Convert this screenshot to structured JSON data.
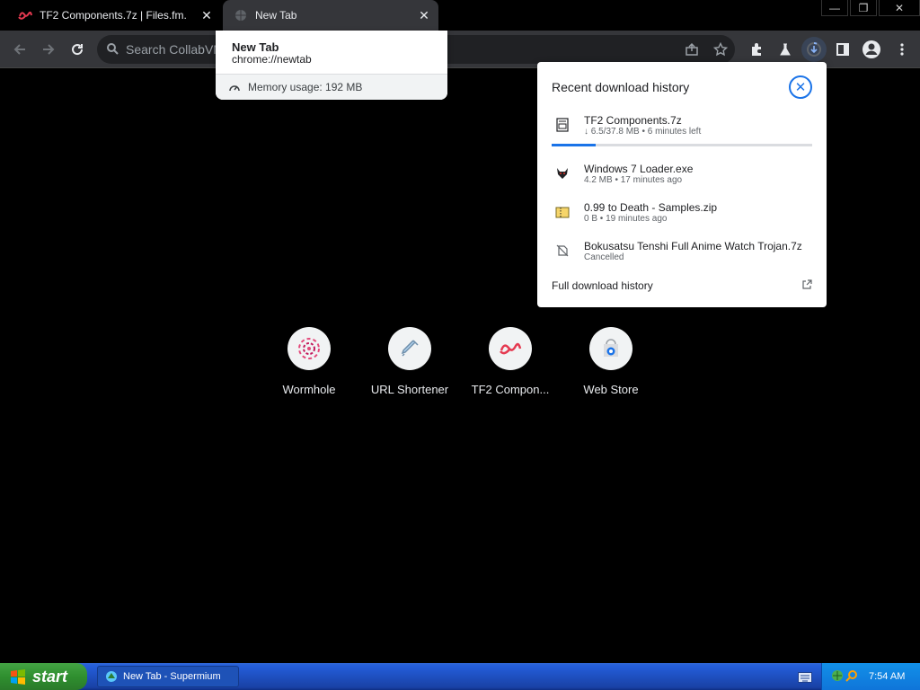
{
  "tabs": [
    {
      "title": "TF2 Components.7z | Files.fm.",
      "close": "✕"
    },
    {
      "title": "New Tab",
      "close": "✕"
    }
  ],
  "window_controls": {
    "minimize": "—",
    "restore": "❐",
    "close": "✕"
  },
  "omnibox": {
    "placeholder": "Search CollabVM"
  },
  "hover_card": {
    "title": "New Tab",
    "url": "chrome://newtab",
    "memory": "Memory usage: 192 MB"
  },
  "downloads": {
    "title": "Recent download history",
    "items": [
      {
        "name": "TF2 Components.7z",
        "status": "↓ 6.5/37.8 MB • 6 minutes left",
        "icon": "archive-icon",
        "progress": 0.17
      },
      {
        "name": "Windows  7  Loader.exe",
        "status": "4.2 MB • 17 minutes ago",
        "icon": "demon-cat-icon"
      },
      {
        "name": "0.99 to Death - Samples.zip",
        "status": "0 B • 19 minutes ago",
        "icon": "zip-folder-icon"
      },
      {
        "name": "Bokusatsu Tenshi Full Anime Watch Trojan.7z",
        "status": "Cancelled",
        "icon": "file-off-icon"
      }
    ],
    "footer": "Full download history"
  },
  "shortcuts": [
    {
      "label": "Wormhole",
      "icon": "wormhole-icon"
    },
    {
      "label": "URL Shortener",
      "icon": "syringe-icon"
    },
    {
      "label": "TF2 Compon...",
      "icon": "filesfm-icon"
    },
    {
      "label": "Web Store",
      "icon": "webstore-icon"
    }
  ],
  "taskbar": {
    "start_label": "start",
    "task_label": "New Tab - Supermium",
    "clock": "7:54 AM"
  },
  "colors": {
    "accent": "#1a73e8",
    "toolbar": "#35363a",
    "background": "#000000",
    "taskbar_blue": "#245edb",
    "start_green": "#2f8f2f"
  }
}
